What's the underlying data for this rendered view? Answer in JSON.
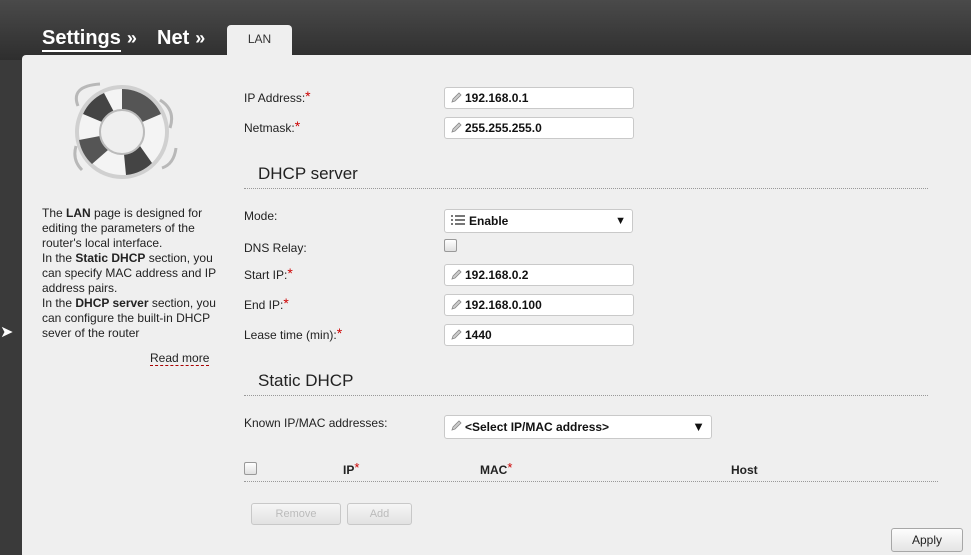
{
  "breadcrumb": {
    "settings": "Settings",
    "net": "Net",
    "separator": "»"
  },
  "tab": {
    "label": "LAN"
  },
  "sidebar": {
    "desc": {
      "p1_pre": "The ",
      "p1_bold": "LAN",
      "p1_post": " page is designed for editing the parameters of the router's local interface.",
      "p2_pre": "In the ",
      "p2_bold": "Static DHCP",
      "p2_post": " section, you can specify MAC address and IP address pairs.",
      "p3_pre": "In the ",
      "p3_bold": "DHCP server",
      "p3_post": " section, you can configure the built-in DHCP sever of the router"
    },
    "read_more": "Read more"
  },
  "lan": {
    "ip_label": "IP Address:",
    "ip_value": "192.168.0.1",
    "mask_label": "Netmask:",
    "mask_value": "255.255.255.0"
  },
  "dhcp": {
    "title": "DHCP server",
    "mode_label": "Mode:",
    "mode_value": "Enable",
    "dns_label": "DNS Relay:",
    "start_label": "Start IP:",
    "start_value": "192.168.0.2",
    "end_label": "End IP:",
    "end_value": "192.168.0.100",
    "lease_label": "Lease time (min):",
    "lease_value": "1440"
  },
  "static": {
    "title": "Static DHCP",
    "known_label": "Known IP/MAC addresses:",
    "known_value": "<Select IP/MAC address>",
    "col_ip": "IP",
    "col_mac": "MAC",
    "col_host": "Host",
    "remove": "Remove",
    "add": "Add"
  },
  "required_mark": "*",
  "apply": "Apply",
  "colors": {
    "header": "#3a3a3a",
    "panel": "#efefef",
    "required": "#cc0000"
  }
}
